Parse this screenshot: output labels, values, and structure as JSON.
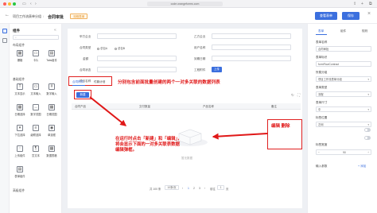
{
  "browser": {
    "url": "code.orangeforms.com",
    "icons": [
      "sidebar-icon",
      "back-icon",
      "forward-icon",
      "share-icon",
      "new-tab-icon",
      "tabs-icon"
    ]
  },
  "header": {
    "crumb_app": "项目工作流表单分组",
    "crumb_sep": "/",
    "crumb_form": "合同审批",
    "status_badge": "流程表单",
    "btn_primary": "查看表单",
    "btn_save": "保存",
    "close_icon": "close-icon"
  },
  "left": {
    "title": "组件",
    "search_placeholder": "",
    "sections": [
      {
        "label": "布局组件",
        "items": [
          "栅格",
          "卡片",
          "Tabs组件"
        ]
      },
      {
        "label": "基础组件",
        "items": [
          "文本显示",
          "文本输入",
          "数字输入",
          "日期选择",
          "数字范围",
          "日期范围",
          "下拉选择",
          "级联选择",
          "单选框",
          "上传组件",
          "富文本",
          "数据表格",
          "表单组件"
        ]
      },
      {
        "label": "高级组件",
        "items": []
      }
    ]
  },
  "form": {
    "row1": [
      {
        "label": "甲方企业",
        "value": ""
      },
      {
        "label": "乙方企业",
        "value": ""
      }
    ],
    "row2": {
      "label": "合同类型",
      "options": [
        "总包A",
        "总包B"
      ],
      "label2": "用户名称"
    },
    "row3": [
      {
        "label": "金额",
        "value": ""
      },
      {
        "label": "到期日期",
        "value": ""
      }
    ],
    "row4": {
      "label": "合同状态",
      "label2": "工程附件",
      "upload_label": "上传"
    },
    "row5": {
      "label": "项目名称"
    },
    "tabs": [
      "合同附件",
      "付款计划"
    ],
    "new_button": "新建",
    "table_columns": [
      "合同产品",
      "交付数量",
      "产品名称",
      "备注"
    ],
    "empty_text": "暂无数据",
    "pager": {
      "total": "共 100 条",
      "page_size": "10条/页",
      "pages": [
        "1",
        "2",
        "3"
      ],
      "goto_label": "前往",
      "goto_value": "1",
      "page_unit": "页"
    }
  },
  "annotations": {
    "tabs_note": "分别包含前面批量创建的两个一对多关联的数据列表",
    "edit_delete": "编辑  删除",
    "click_note_l1": "在运行时点击「新建」和「编辑」，",
    "click_note_l2": "将会显示下面的一对多关联表数据",
    "click_note_l3": "编辑弹框。"
  },
  "right": {
    "tabs": [
      "表单",
      "组件",
      "规则"
    ],
    "fields": [
      {
        "label": "表单名称",
        "value": "合同审批"
      },
      {
        "label": "表单标识",
        "value": "formFlowContract"
      },
      {
        "label": "所属分组",
        "value": "项目工作流表单分组"
      },
      {
        "label": "表单类型",
        "value": "流程"
      },
      {
        "label": "表单尺寸",
        "value": "中"
      },
      {
        "label": "标签位置",
        "value": "左侧"
      },
      {
        "label": "标签宽度",
        "value": "90"
      }
    ],
    "footer_label": "输入参数",
    "footer_action": "+ 添加"
  },
  "colors": {
    "primary": "#3b6fde",
    "annotation": "#e01818",
    "draft_border": "#f1b25f"
  }
}
